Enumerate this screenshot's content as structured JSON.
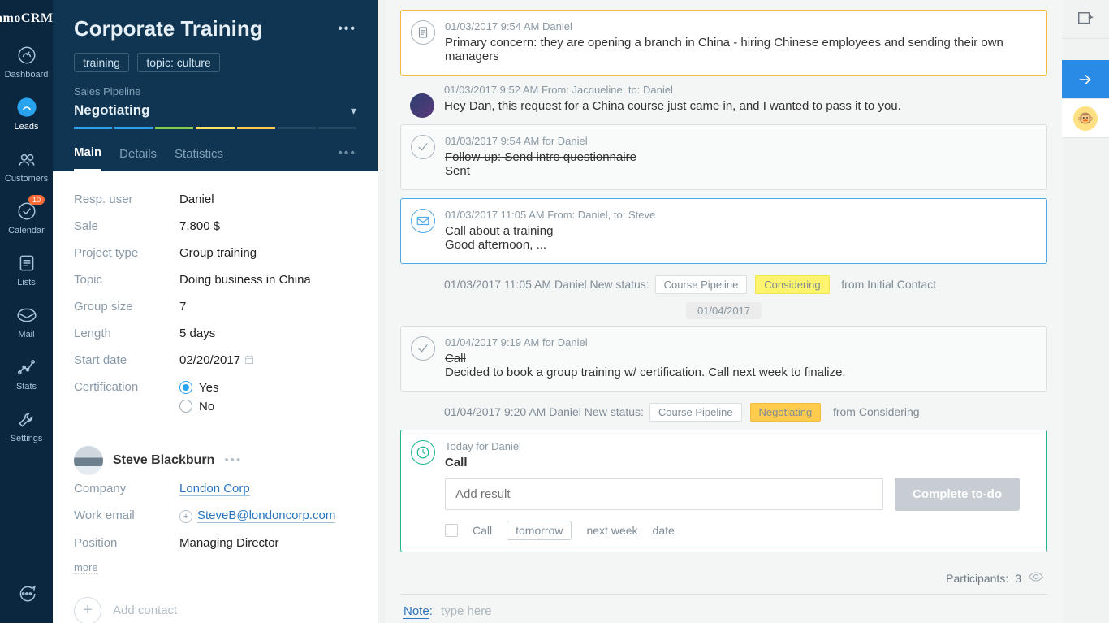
{
  "nav": {
    "logo": "amoCRM.",
    "items": [
      {
        "label": "Dashboard"
      },
      {
        "label": "Leads",
        "active": true
      },
      {
        "label": "Customers"
      },
      {
        "label": "Calendar",
        "badge": "10"
      },
      {
        "label": "Lists"
      },
      {
        "label": "Mail"
      },
      {
        "label": "Stats"
      },
      {
        "label": "Settings"
      }
    ]
  },
  "lead": {
    "title": "Corporate Training",
    "tags": [
      "training",
      "topic: culture"
    ],
    "pipeline_label": "Sales Pipeline",
    "stage": "Negotiating",
    "stage_colors": [
      "#2aa3ef",
      "#2aa3ef",
      "#86c94f",
      "#ffe066",
      "#ffcc4d",
      "#244a63",
      "#244a63"
    ],
    "tabs": {
      "main": "Main",
      "details": "Details",
      "stats": "Statistics"
    },
    "fields": {
      "resp_user": {
        "label": "Resp. user",
        "value": "Daniel"
      },
      "sale": {
        "label": "Sale",
        "value": "7,800 $"
      },
      "project_type": {
        "label": "Project type",
        "value": "Group training"
      },
      "topic": {
        "label": "Topic",
        "value": "Doing business in China"
      },
      "group_size": {
        "label": "Group size",
        "value": "7"
      },
      "length": {
        "label": "Length",
        "value": "5 days"
      },
      "start_date": {
        "label": "Start date",
        "value": "02/20/2017"
      },
      "certification": {
        "label": "Certification",
        "yes": "Yes",
        "no": "No",
        "value": "Yes"
      }
    },
    "contact": {
      "name": "Steve Blackburn",
      "company_label": "Company",
      "company": "London Corp",
      "email_label": "Work email",
      "email": "SteveB@londoncorp.com",
      "position_label": "Position",
      "position": "Managing Director",
      "more": "more"
    },
    "add_contact": "Add contact"
  },
  "feed": {
    "items": [
      {
        "kind": "primary",
        "meta": "01/03/2017 9:54 AM Daniel",
        "text": "Primary concern: they are opening a branch in China - hiring Chinese employees and sending their own managers"
      },
      {
        "kind": "avatar",
        "meta": "01/03/2017 9:52 AM From: Jacqueline, to: Daniel",
        "text": "Hey Dan, this request for a China course just came in, and I wanted to pass it to you."
      },
      {
        "kind": "task_done",
        "meta": "01/03/2017 9:54 AM for Daniel",
        "title": "Follow-up: Send intro questionnaire",
        "text": "Sent"
      },
      {
        "kind": "email",
        "meta": "01/03/2017 11:05 AM From: Daniel, to: Steve",
        "title": "Call about a training",
        "text": "Good afternoon, ..."
      },
      {
        "kind": "status",
        "meta": "01/03/2017 11:05 AM Daniel New status:",
        "pipeline": "Course Pipeline",
        "status": "Considering",
        "from": "from Initial Contact",
        "chip_class": "yellow"
      },
      {
        "kind": "divider",
        "date": "01/04/2017"
      },
      {
        "kind": "task_done",
        "meta": "01/04/2017 9:19 AM for Daniel",
        "title": "Call",
        "text": "Decided to book a group training w/ certification. Call next week to finalize."
      },
      {
        "kind": "status",
        "meta": "01/04/2017 9:20 AM Daniel New status:",
        "pipeline": "Course Pipeline",
        "status": "Negotiating",
        "from": "from Considering",
        "chip_class": "orange"
      }
    ],
    "today": {
      "meta": "Today for Daniel",
      "title": "Call",
      "result_placeholder": "Add result",
      "complete": "Complete to-do",
      "quick": {
        "call": "Call",
        "tomorrow": "tomorrow",
        "next_week": "next week",
        "date": "date"
      }
    },
    "participants_label": "Participants:",
    "participants_count": "3",
    "compose_label": "Note",
    "compose_placeholder": "type here"
  }
}
